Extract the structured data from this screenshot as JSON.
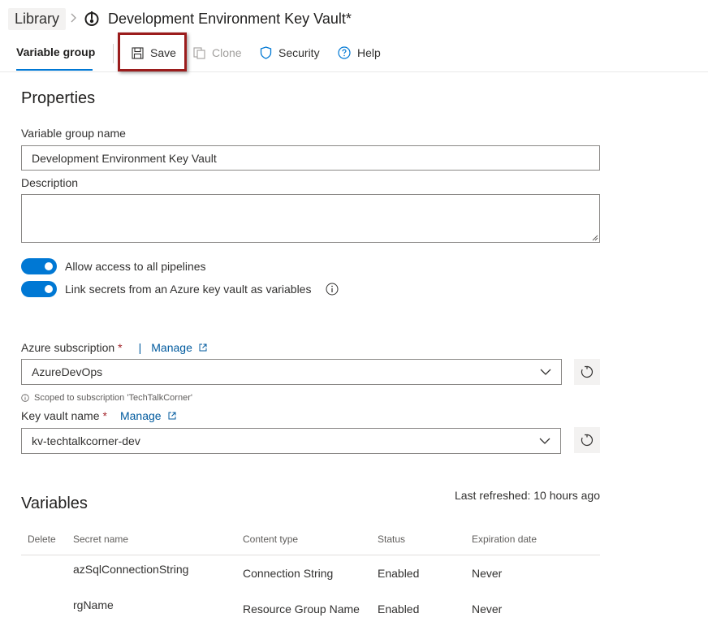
{
  "breadcrumb": {
    "library": "Library",
    "title": "Development Environment Key Vault*"
  },
  "toolbar": {
    "tab_label": "Variable group",
    "save_label": "Save",
    "clone_label": "Clone",
    "security_label": "Security",
    "help_label": "Help"
  },
  "properties": {
    "heading": "Properties",
    "name_label": "Variable group name",
    "name_value": "Development Environment Key Vault",
    "description_label": "Description",
    "description_value": "",
    "toggle_pipelines_label": "Allow access to all pipelines",
    "toggle_pipelines_on": true,
    "toggle_keyvault_label": "Link secrets from an Azure key vault as variables",
    "toggle_keyvault_on": true
  },
  "keyvault": {
    "subscription_label": "Azure subscription",
    "required_mark": "*",
    "pipe": "|",
    "manage_label": "Manage",
    "subscription_value": "AzureDevOps",
    "scope_note": "Scoped to subscription 'TechTalkCorner'",
    "vault_label": "Key vault name",
    "vault_value": "kv-techtalkcorner-dev"
  },
  "variables": {
    "heading": "Variables",
    "last_refreshed": "Last refreshed: 10 hours ago",
    "columns": [
      "Delete",
      "Secret name",
      "Content type",
      "Status",
      "Expiration date"
    ],
    "rows": [
      {
        "secret_name": "azSqlConnectionString",
        "content_type": "Connection String",
        "status": "Enabled",
        "expiration": "Never"
      },
      {
        "secret_name": "rgName",
        "content_type": "Resource Group Name",
        "status": "Enabled",
        "expiration": "Never"
      }
    ]
  },
  "colors": {
    "accent": "#0078d4",
    "link": "#005a9e",
    "highlight_box": "#9b1c1c",
    "required": "#a4262c"
  }
}
